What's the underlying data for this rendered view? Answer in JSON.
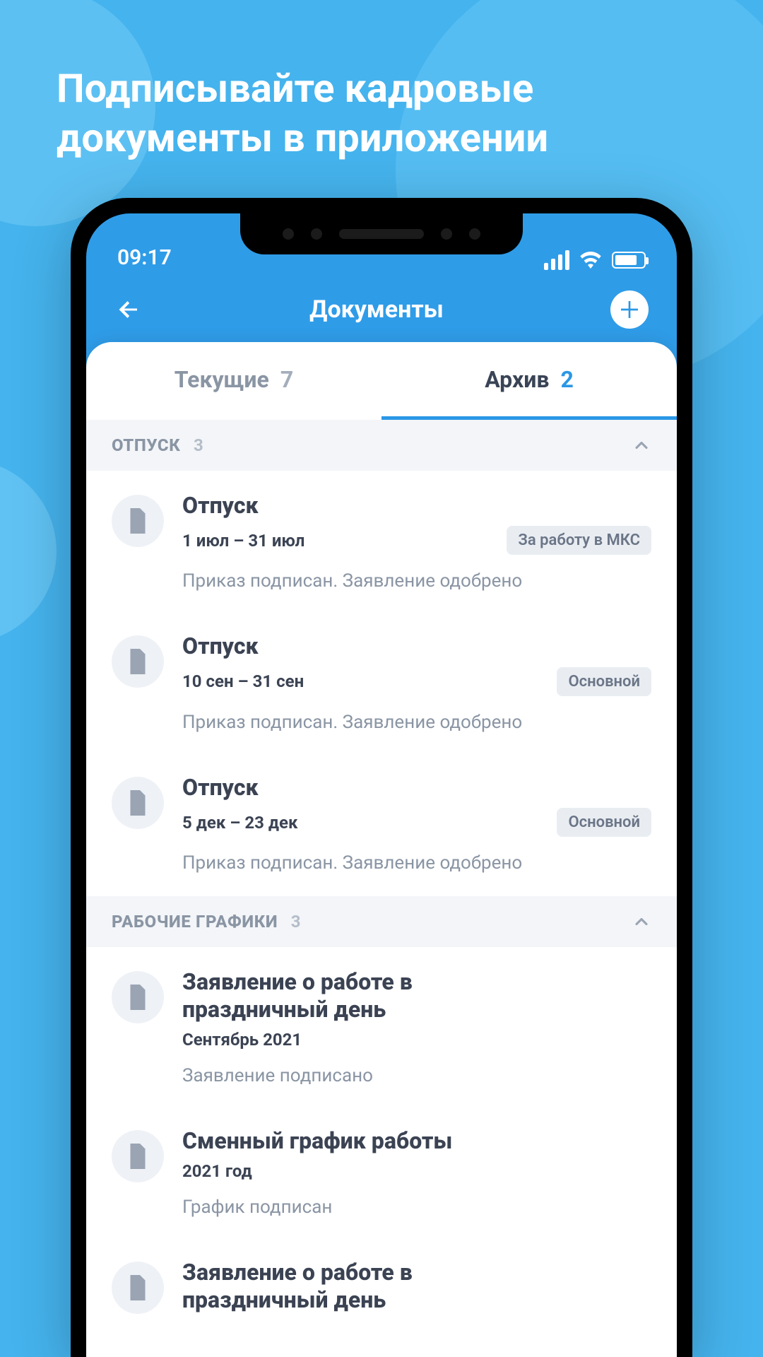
{
  "promo": {
    "headline": "Подписывайте кадровые документы в приложении"
  },
  "statusbar": {
    "time": "09:17"
  },
  "nav": {
    "title": "Документы"
  },
  "tabs": {
    "current": {
      "label": "Текущие",
      "count": "7"
    },
    "archive": {
      "label": "Архив",
      "count": "2"
    }
  },
  "sections": [
    {
      "title": "ОТПУСК",
      "count": "3",
      "items": [
        {
          "title": "Отпуск",
          "dates": "1 июл – 31 июл",
          "badge": "За работу в МКС",
          "status": "Приказ подписан. Заявление одобрено"
        },
        {
          "title": "Отпуск",
          "dates": "10 сен – 31 сен",
          "badge": "Основной",
          "status": "Приказ подписан. Заявление одобрено"
        },
        {
          "title": "Отпуск",
          "dates": "5 дек – 23 дек",
          "badge": "Основной",
          "status": "Приказ подписан. Заявление одобрено"
        }
      ]
    },
    {
      "title": "РАБОЧИЕ ГРАФИКИ",
      "count": "3",
      "items": [
        {
          "title": "Заявление о работе в праздничный день",
          "dates": "Сентябрь 2021",
          "badge": "",
          "status": "Заявление подписано"
        },
        {
          "title": "Сменный график работы",
          "dates": "2021 год",
          "badge": "",
          "status": "График подписан"
        },
        {
          "title": "Заявление о работе в праздничный день",
          "dates": "",
          "badge": "",
          "status": ""
        }
      ]
    }
  ]
}
